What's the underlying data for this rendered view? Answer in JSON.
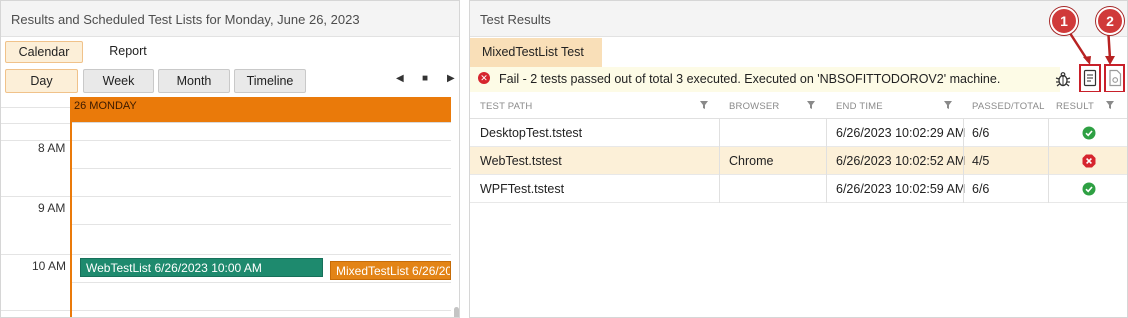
{
  "left_panel": {
    "title": "Results and Scheduled Test Lists for Monday, June 26, 2023",
    "tabs": [
      "Calendar",
      "Report"
    ],
    "modes": [
      "Day",
      "Week",
      "Month",
      "Timeline"
    ],
    "active_mode": "Day",
    "calendar": {
      "day_header": "26 MONDAY",
      "time_labels": [
        "8 AM",
        "9 AM",
        "10 AM"
      ],
      "events": [
        {
          "label": "WebTestList 6/26/2023 10:00 AM",
          "color": "#1e8a6e"
        },
        {
          "label": "MixedTestList 6/26/20",
          "color": "#e38416"
        }
      ]
    }
  },
  "right_panel": {
    "title": "Test Results",
    "breadcrumb": "MixedTestList Tests",
    "status": "Fail - 2 tests passed out of total 3 executed. Executed on 'NBSOFITTODOROV2' machine.",
    "callouts": [
      "1",
      "2"
    ],
    "columns": [
      "TEST PATH",
      "BROWSER",
      "END TIME",
      "PASSED/TOTAL",
      "RESULT"
    ],
    "rows": [
      {
        "path": "DesktopTest.tstest",
        "browser": "",
        "end_time": "6/26/2023 10:02:29 AM",
        "passed": "6/6",
        "result": "pass"
      },
      {
        "path": "WebTest.tstest",
        "browser": "Chrome",
        "end_time": "6/26/2023 10:02:52 AM",
        "passed": "4/5",
        "result": "fail"
      },
      {
        "path": "WPFTest.tstest",
        "browser": "",
        "end_time": "6/26/2023 10:02:59 AM",
        "passed": "6/6",
        "result": "pass"
      }
    ],
    "colors": {
      "pass": "#2ea043",
      "fail": "#d6252e",
      "accent": "#ea7a0a",
      "highlight": "#c8202a"
    }
  }
}
